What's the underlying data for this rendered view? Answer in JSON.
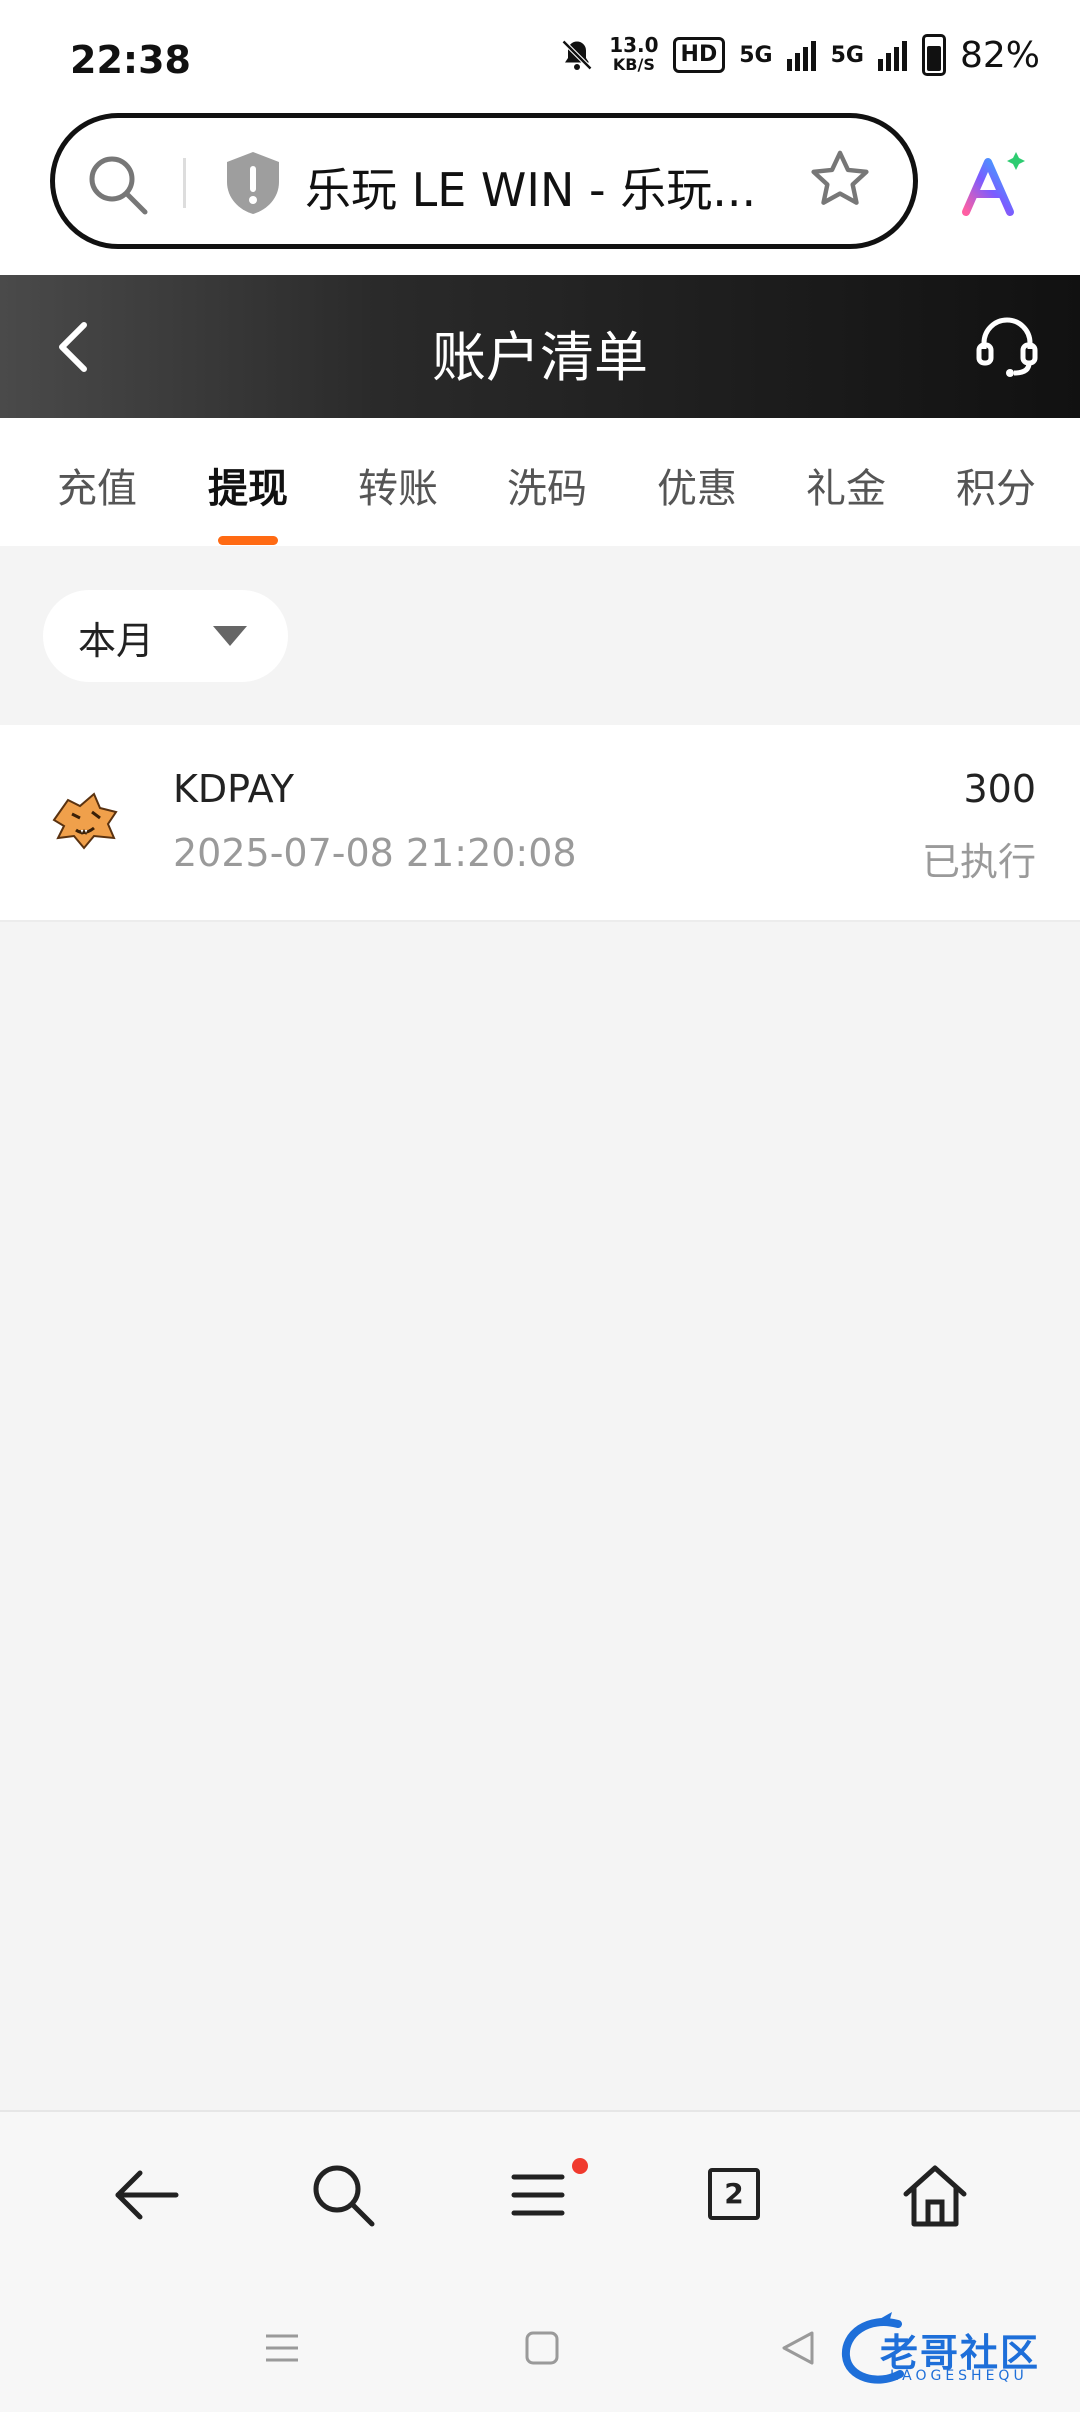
{
  "status_bar": {
    "time": "22:38",
    "speed_value": "13.0",
    "speed_unit": "KB/S",
    "hd_label": "HD",
    "network_1": "5G",
    "network_2": "5G",
    "battery": "82%"
  },
  "browser": {
    "url_title": "乐玩 LE WIN - 乐玩..."
  },
  "header": {
    "title": "账户清单"
  },
  "tabs": [
    {
      "label": "充值"
    },
    {
      "label": "提现"
    },
    {
      "label": "转账"
    },
    {
      "label": "洗码"
    },
    {
      "label": "优惠"
    },
    {
      "label": "礼金"
    },
    {
      "label": "积分"
    }
  ],
  "active_tab": "提现",
  "filter": {
    "selected": "本月"
  },
  "records": [
    {
      "name": "KDPAY",
      "time": "2025-07-08 21:20:08",
      "amount": "300",
      "status": "已执行"
    }
  ],
  "toolbar": {
    "tab_count": "2"
  },
  "watermark": {
    "text": "老哥社区",
    "sub": "LAOGESHEQU"
  },
  "colors": {
    "accent": "#ff6a13",
    "header_dark": "#111111",
    "badge_red": "#f03a2e"
  }
}
